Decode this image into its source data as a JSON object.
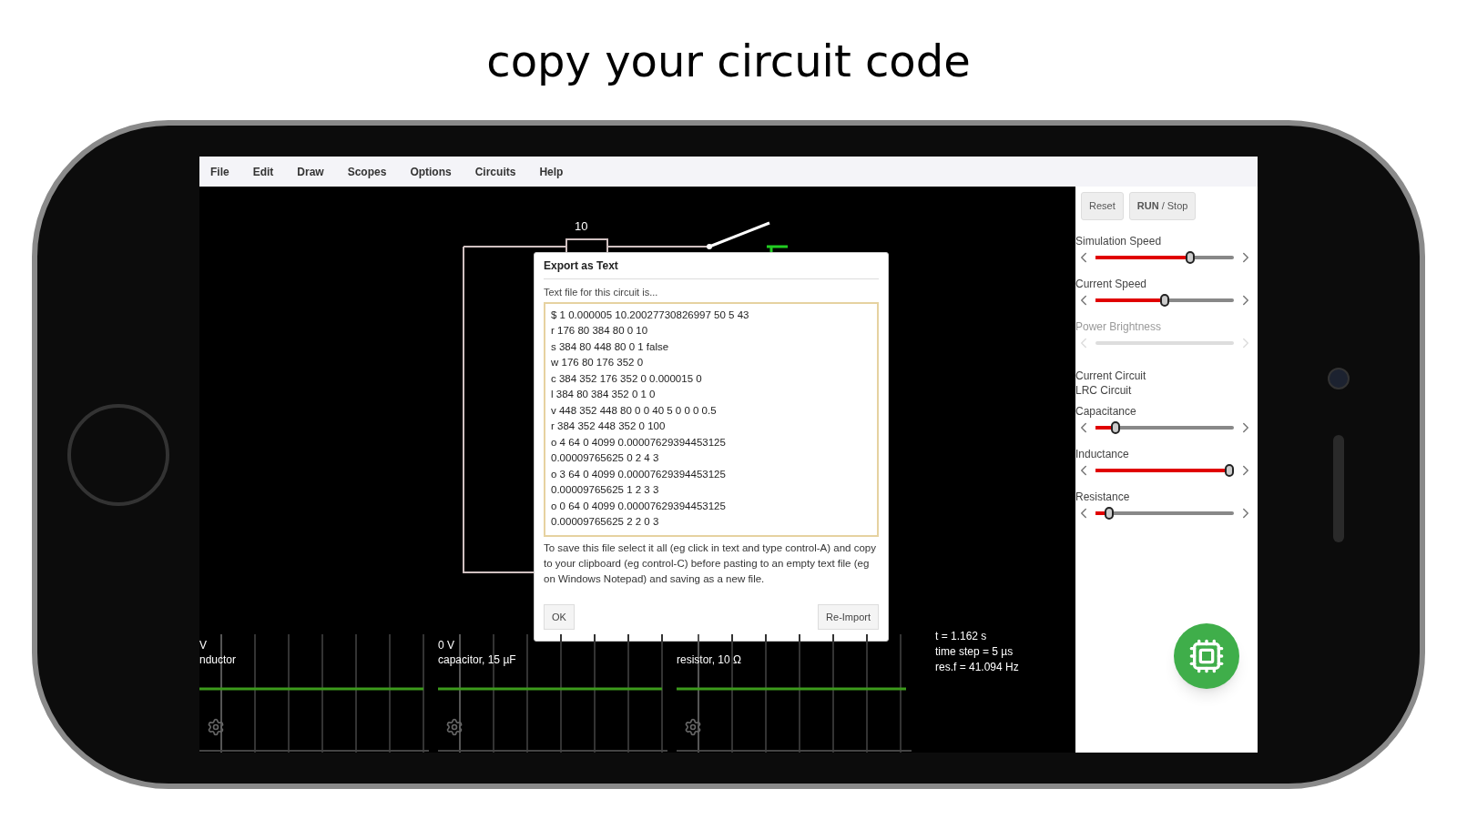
{
  "headline": "copy your circuit code",
  "menu": [
    "File",
    "Edit",
    "Draw",
    "Scopes",
    "Options",
    "Circuits",
    "Help"
  ],
  "circuit": {
    "resistor_label": "10"
  },
  "dialog": {
    "title": "Export as Text",
    "subtitle": "Text file for this circuit is...",
    "code_lines": [
      "$ 1 0.000005 10.20027730826997 50 5 43",
      "r 176 80 384 80 0 10",
      "s 384 80 448 80 0 1 false",
      "w 176 80 176 352 0",
      "c 384 352 176 352 0 0.000015 0",
      "l 384 80 384 352 0 1 0",
      "v 448 352 448 80 0 0 40 5 0 0 0 0.5",
      "r 384 352 448 352 0 100",
      "o 4 64 0 4099 0.00007629394453125",
      "0.00009765625 0 2 4 3",
      "o 3 64 0 4099 0.00007629394453125",
      "0.00009765625 1 2 3 3",
      "o 0 64 0 4099 0.00007629394453125",
      "0.00009765625 2 2 0 3"
    ],
    "instructions": "To save this file select it all (eg click in text and type control-A) and copy to your clipboard (eg control-C) before pasting to an empty text file (eg on Windows Notepad) and saving as a new file.",
    "buttons": [
      "OK",
      "Re-Import"
    ]
  },
  "scopes": [
    {
      "voltage": "V",
      "label": "nductor"
    },
    {
      "voltage": "0 V",
      "label": "capacitor, 15 µF"
    },
    {
      "label": "resistor, 10 Ω"
    }
  ],
  "info": [
    "t = 1.162 s",
    "time step = 5 µs",
    "res.f = 41.094 Hz"
  ],
  "panel": {
    "buttons": [
      "Reset",
      "**RUN** / Stop"
    ],
    "sliders_top": [
      {
        "label": "Simulation Speed",
        "level": 0.7,
        "disabled": false
      },
      {
        "label": "Current Speed",
        "level": 0.5,
        "disabled": false
      },
      {
        "label": "Power Brightness",
        "disabled": true
      }
    ],
    "current_circuit": {
      "label": "Current Circuit",
      "value": "LRC Circuit"
    },
    "sliders_bottom": [
      {
        "label": "Capacitance",
        "level": 0.12,
        "disabled": false
      },
      {
        "label": "Inductance",
        "level": 1,
        "disabled": false
      },
      {
        "label": "Resistance",
        "level": 0.07,
        "disabled": false
      }
    ]
  }
}
